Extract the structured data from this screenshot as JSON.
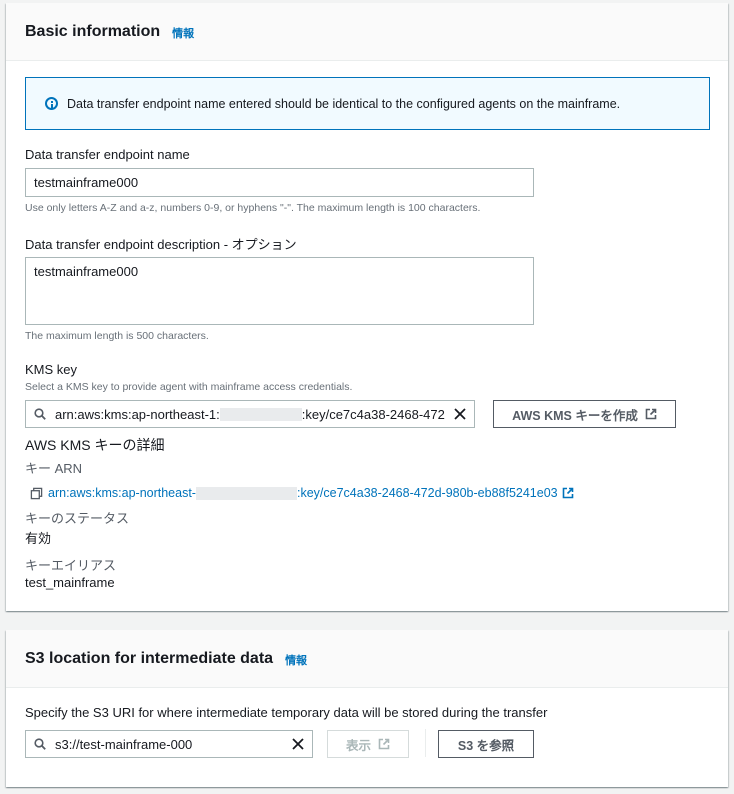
{
  "basic": {
    "title": "Basic information",
    "info": "情報",
    "alert": "Data transfer endpoint name entered should be identical to the configured agents on the mainframe.",
    "name_label": "Data transfer endpoint name",
    "name_value": "testmainframe000",
    "name_hint": "Use only letters A-Z and a-z, numbers 0-9, or hyphens \"-\". The maximum length is 100 characters.",
    "desc_label": "Data transfer endpoint description - オプション",
    "desc_value": "testmainframe000",
    "desc_hint": "The maximum length is 500 characters.",
    "kms_label": "KMS key",
    "kms_hint": "Select a KMS key to provide agent with mainframe access credentials.",
    "kms_value_prefix": "arn:aws:kms:ap-northeast-1:",
    "kms_value_suffix": ":key/ce7c4a38-2468-472",
    "create_kms_button": "AWS KMS キーを作成",
    "details_title": "AWS KMS キーの詳細",
    "arn_label": "キー ARN",
    "arn_prefix": "arn:aws:kms:ap-northeast-",
    "arn_suffix": ":key/ce7c4a38-2468-472d-980b-eb88f5241e03",
    "status_label": "キーのステータス",
    "status_value": "有効",
    "alias_label": "キーエイリアス",
    "alias_value": "test_mainframe"
  },
  "s3": {
    "title": "S3 location for intermediate data",
    "info": "情報",
    "description": "Specify the S3 URI for where intermediate temporary data will be stored during the transfer",
    "uri_value": "s3://test-mainframe-000",
    "view_button": "表示",
    "browse_button": "S3 を参照"
  },
  "colors": {
    "link": "#0073bb",
    "alert_bg": "#f1faff",
    "text": "#16191f",
    "hint": "#687078"
  }
}
